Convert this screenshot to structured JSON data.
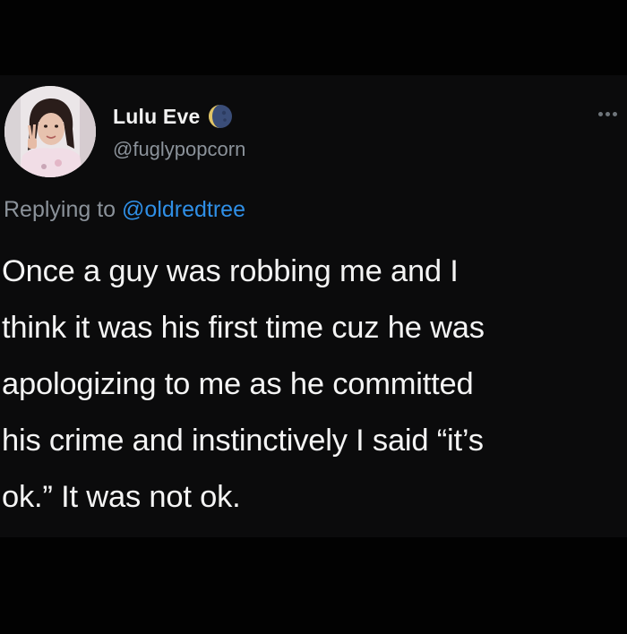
{
  "author": {
    "display_name": "Lulu Eve",
    "handle": "@fuglypopcorn",
    "badge_icon": "moon-emoji-icon",
    "avatar_icon": "profile-photo"
  },
  "menu": {
    "icon": "more-options-icon"
  },
  "reply": {
    "prefix": "Replying to",
    "target": "@oldredtree"
  },
  "tweet": {
    "lines": [
      "Once a guy was robbing me and I",
      "think it was his first time cuz he was",
      "apologizing to me as he committed",
      "his crime and instinctively I said “it’s",
      "ok.” It was not ok."
    ]
  },
  "colors": {
    "background": "#000000",
    "card": "#0b0b0c",
    "text": "#f4f4f4",
    "muted": "#8b929a",
    "link": "#2f8fe6"
  }
}
